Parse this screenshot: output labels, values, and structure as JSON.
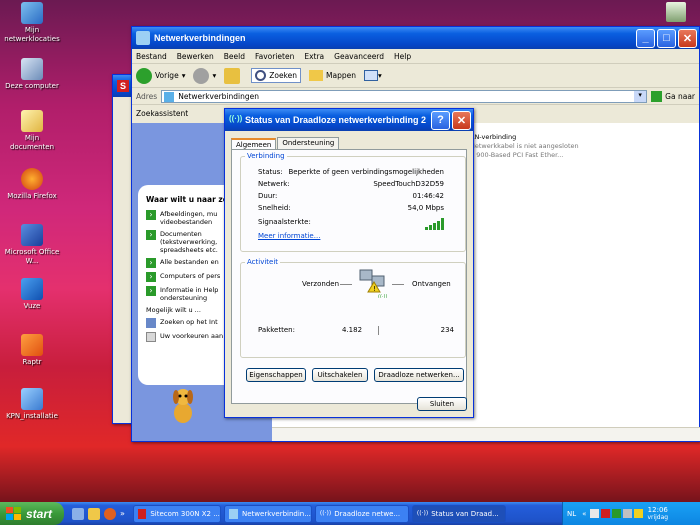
{
  "desktop": {
    "icons": [
      {
        "label": "Mijn netwerklocaties"
      },
      {
        "label": "Deze computer"
      },
      {
        "label": "Mijn documenten"
      },
      {
        "label": "Mozilla Firefox"
      },
      {
        "label": "Microsoft Office W..."
      },
      {
        "label": "Vuze"
      },
      {
        "label": "Raptr"
      },
      {
        "label": "KPN_installatie"
      }
    ]
  },
  "explorer": {
    "title": "Netwerkverbindingen",
    "menu": [
      "Bestand",
      "Bewerken",
      "Beeld",
      "Favorieten",
      "Extra",
      "Geavanceerd",
      "Help"
    ],
    "toolbar": {
      "back": "Vorige",
      "search": "Zoeken",
      "folders": "Mappen"
    },
    "address": {
      "label": "Adres",
      "value": "Netwerkverbindingen",
      "go": "Ga naar"
    },
    "search_pane_title": "Zoekassistent",
    "right_lines": [
      "AN-verbinding",
      "Netwerkkabel is niet aangesloten",
      "S 900-Based PCI Fast Ether..."
    ]
  },
  "search_assistant": {
    "heading": "Waar wilt u naar zoe",
    "items": [
      "Afbeeldingen, mu videobestanden",
      "Documenten (tekstverwerking, spreadsheets etc.",
      "Alle bestanden en",
      "Computers of pers",
      "Informatie in Help ondersteuning"
    ],
    "also": "Mogelijk wilt u ...",
    "extra_items": [
      "Zoeken op het Int",
      "Uw voorkeuren aan"
    ]
  },
  "dialog": {
    "title": "Status van Draadloze netwerkverbinding 2",
    "tabs": [
      "Algemeen",
      "Ondersteuning"
    ],
    "connection_group": "Verbinding",
    "fields": [
      {
        "label": "Status:",
        "value": "Beperkte of geen verbindingsmogelijkheden"
      },
      {
        "label": "Netwerk:",
        "value": "SpeedTouchD32D59"
      },
      {
        "label": "Duur:",
        "value": "01:46:42"
      },
      {
        "label": "Snelheid:",
        "value": "54,0 Mbps"
      }
    ],
    "signal_label": "Signaalsterkte:",
    "more_info": "Meer informatie...",
    "activity_group": "Activiteit",
    "sent_label": "Verzonden",
    "received_label": "Ontvangen",
    "packets_label": "Pakketten:",
    "packets_sent": "4.182",
    "packets_received": "234",
    "buttons": {
      "properties": "Eigenschappen",
      "disable": "Uitschakelen",
      "wireless": "Draadloze netwerken...",
      "close": "Sluiten"
    }
  },
  "taskbar": {
    "start": "start",
    "items": [
      "Sitecom 300N X2 ...",
      "Netwerkverbindin...",
      "Draadloze netwe...",
      "Status van Draad..."
    ],
    "lang": "NL",
    "time": "12:06",
    "day": "vrijdag"
  },
  "colors": {
    "xp_blue": "#0a5fe0",
    "desktop_pink": "#d0287a",
    "start_green": "#3a9a3a"
  }
}
